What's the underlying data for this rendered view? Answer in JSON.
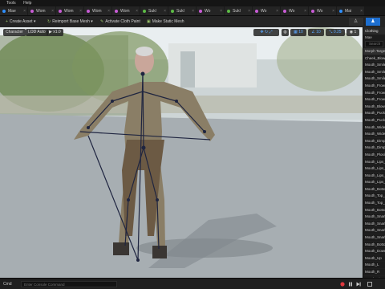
{
  "menu": [
    "Tools",
    "Help"
  ],
  "tabs": [
    {
      "label": "Mae",
      "color": "#2e8fff"
    },
    {
      "label": "Wom",
      "color": "#c95cd6"
    },
    {
      "label": "Wom",
      "color": "#c95cd6"
    },
    {
      "label": "Wom",
      "color": "#c95cd6"
    },
    {
      "label": "Wom",
      "color": "#c95cd6"
    },
    {
      "label": "Sukl",
      "color": "#5dbb46"
    },
    {
      "label": "Sukl",
      "color": "#5dbb46"
    },
    {
      "label": "Wo",
      "color": "#c95cd6"
    },
    {
      "label": "Sukl",
      "color": "#5dbb46"
    },
    {
      "label": "Wo",
      "color": "#c95cd6"
    },
    {
      "label": "Wo",
      "color": "#c95cd6"
    },
    {
      "label": "Wo",
      "color": "#c95cd6"
    },
    {
      "label": "Mai",
      "color": "#2e8fff"
    }
  ],
  "toolbar": {
    "create_asset": "Create Asset",
    "reimport": "Reimport Base Mesh",
    "activate_cloth": "Activate Cloth Paint",
    "make_static": "Make Static Mesh"
  },
  "right_tools": [
    "Skeleton",
    "Mesh"
  ],
  "viewport": {
    "chips": [
      "Character",
      "LOD Auto",
      "x1.0"
    ],
    "right_chips": [
      "0.25",
      "10",
      "10",
      "1"
    ]
  },
  "panel": {
    "tab": "Clothing",
    "header": "Mae",
    "search_placeholder": "Search",
    "rows": [
      "Morph Target",
      "Cheek_Blow_L",
      "Mouth_Smile",
      "Mouth_Smile",
      "Mouth_Smile",
      "Mouth_Frown",
      "Mouth_Frown",
      "Mouth_Frown",
      "Mouth_Blow",
      "Mouth_Pucke",
      "Mouth_Pucke",
      "Mouth_Widen",
      "Mouth_Widen",
      "Mouth_Dimple",
      "Mouth_Dimple",
      "Mouth_Plosiv",
      "Mouth_Lips_T",
      "Mouth_Lips_T",
      "Mouth_Lips_T",
      "Mouth_Lips_T",
      "Mouth_Bottom",
      "Mouth_Top_L",
      "Mouth_Top_L",
      "Mouth_Bottom",
      "Mouth_Snarl_",
      "Mouth_Snarl_",
      "Mouth_Snarl_",
      "Mouth_Snarl_",
      "Mouth_Bottom",
      "Mouth_Down",
      "Mouth_Up",
      "Mouth_L",
      "Mouth_R",
      "Mouth_Lips_J",
      "Mouth_Lips_J"
    ]
  },
  "bottom": {
    "cmd_label": "Cmd",
    "cmd_placeholder": "Enter Console Command",
    "left_items": [
      "Content Drawer",
      "Output Log"
    ]
  }
}
